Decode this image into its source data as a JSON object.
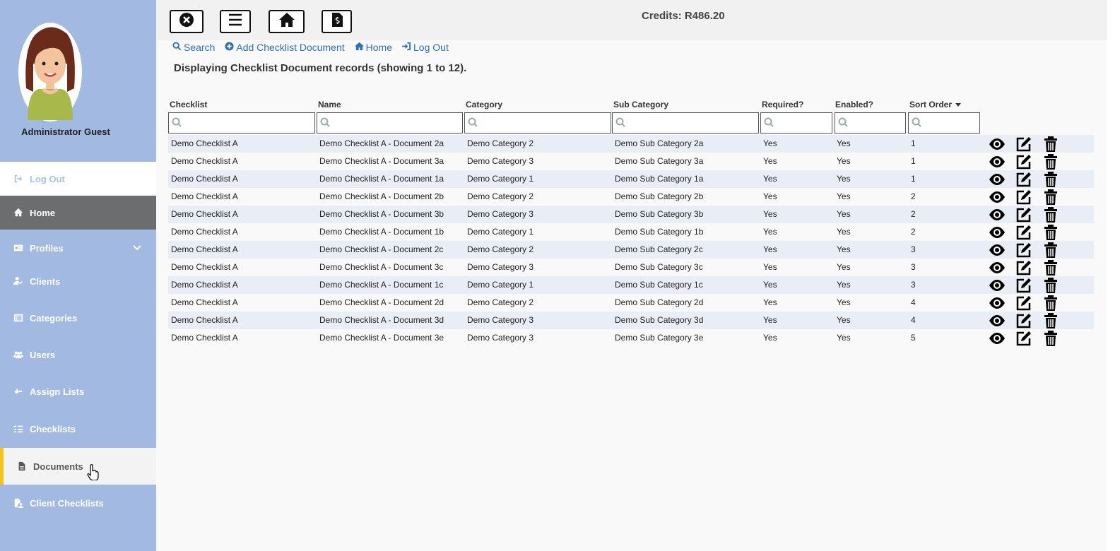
{
  "user": {
    "name": "Administrator Guest"
  },
  "sidebar": {
    "items": [
      {
        "label": "Log Out",
        "icon": "sign-out-icon"
      },
      {
        "label": "Home",
        "icon": "home-icon"
      },
      {
        "label": "Profiles",
        "icon": "id-card-icon"
      },
      {
        "label": "Clients",
        "icon": "user-check-icon"
      },
      {
        "label": "Categories",
        "icon": "list-alt-icon"
      },
      {
        "label": "Users",
        "icon": "users-icon"
      },
      {
        "label": "Assign Lists",
        "icon": "hand-point-icon"
      },
      {
        "label": "Checklists",
        "icon": "tasks-icon"
      },
      {
        "label": "Documents",
        "icon": "file-icon"
      },
      {
        "label": "Client Checklists",
        "icon": "file-user-icon"
      }
    ],
    "active": "Documents"
  },
  "topbar": {
    "credits": "Credits: R486.20"
  },
  "actions": {
    "search": "Search",
    "add": "Add Checklist Document",
    "home": "Home",
    "logout": "Log Out"
  },
  "display_text": "Displaying Checklist Document records (showing 1 to 12).",
  "table": {
    "headers": [
      "Checklist",
      "Name",
      "Category",
      "Sub Category",
      "Required?",
      "Enabled?",
      "Sort Order"
    ],
    "rows": [
      [
        "Demo Checklist A",
        "Demo Checklist A - Document 2a",
        "Demo Category 2",
        "Demo Sub Category 2a",
        "Yes",
        "Yes",
        "1"
      ],
      [
        "Demo Checklist A",
        "Demo Checklist A - Document 3a",
        "Demo Category 3",
        "Demo Sub Category 3a",
        "Yes",
        "Yes",
        "1"
      ],
      [
        "Demo Checklist A",
        "Demo Checklist A - Document 1a",
        "Demo Category 1",
        "Demo Sub Category 1a",
        "Yes",
        "Yes",
        "1"
      ],
      [
        "Demo Checklist A",
        "Demo Checklist A - Document 2b",
        "Demo Category 2",
        "Demo Sub Category 2b",
        "Yes",
        "Yes",
        "2"
      ],
      [
        "Demo Checklist A",
        "Demo Checklist A - Document 3b",
        "Demo Category 3",
        "Demo Sub Category 3b",
        "Yes",
        "Yes",
        "2"
      ],
      [
        "Demo Checklist A",
        "Demo Checklist A - Document 1b",
        "Demo Category 1",
        "Demo Sub Category 1b",
        "Yes",
        "Yes",
        "2"
      ],
      [
        "Demo Checklist A",
        "Demo Checklist A - Document 2c",
        "Demo Category 2",
        "Demo Sub Category 2c",
        "Yes",
        "Yes",
        "3"
      ],
      [
        "Demo Checklist A",
        "Demo Checklist A - Document 3c",
        "Demo Category 3",
        "Demo Sub Category 3c",
        "Yes",
        "Yes",
        "3"
      ],
      [
        "Demo Checklist A",
        "Demo Checklist A - Document 1c",
        "Demo Category 1",
        "Demo Sub Category 1c",
        "Yes",
        "Yes",
        "3"
      ],
      [
        "Demo Checklist A",
        "Demo Checklist A - Document 2d",
        "Demo Category 2",
        "Demo Sub Category 2d",
        "Yes",
        "Yes",
        "4"
      ],
      [
        "Demo Checklist A",
        "Demo Checklist A - Document 3d",
        "Demo Category 3",
        "Demo Sub Category 3d",
        "Yes",
        "Yes",
        "4"
      ],
      [
        "Demo Checklist A",
        "Demo Checklist A - Document 3e",
        "Demo Category 3",
        "Demo Sub Category 3e",
        "Yes",
        "Yes",
        "5"
      ]
    ]
  },
  "colors": {
    "sidebar": "#a2b9e1",
    "active_accent": "#f5c31d",
    "link": "#2f6fb4",
    "row_stripe": "#e9edf6"
  }
}
